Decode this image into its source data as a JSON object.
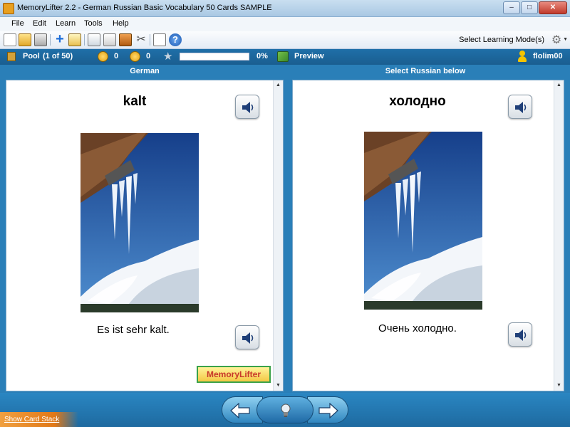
{
  "window": {
    "title": "MemoryLifter 2.2 - German Russian Basic Vocabulary 50 Cards SAMPLE",
    "buttons": {
      "minimize": "–",
      "maximize": "□",
      "close": "✕"
    }
  },
  "menu": [
    "File",
    "Edit",
    "Learn",
    "Tools",
    "Help"
  ],
  "toolbar": {
    "mode_label": "Select Learning Mode(s)",
    "icons": [
      "new-icon",
      "open-icon",
      "print-icon",
      "add-icon",
      "edit-icon",
      "presentation-icon",
      "stack-icon",
      "box-icon",
      "tools-icon",
      "lock-icon",
      "help-icon",
      "gear-icon"
    ]
  },
  "status": {
    "pool_label": "Pool",
    "pool_count": "(1 of 50)",
    "happy_count": "0",
    "sad_count": "0",
    "progress_label": "0%",
    "progress_fraction": 0,
    "preview_label": "Preview",
    "user": "flolim00"
  },
  "question": {
    "header": "German",
    "word": "kalt",
    "sentence": "Es ist sehr kalt."
  },
  "answer": {
    "header": "Select Russian below",
    "word": "холодно",
    "sentence": "Очень холодно."
  },
  "logo_text": "MemoryLifter",
  "bottom": {
    "show_stack": "Show Card Stack"
  },
  "colors": {
    "accent": "#1f6fa8",
    "sky": "#1e4f9a",
    "logo_border": "#3aa24a"
  }
}
